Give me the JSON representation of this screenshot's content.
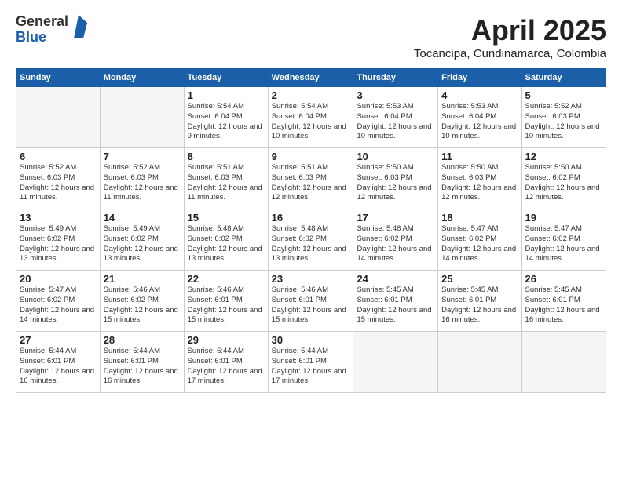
{
  "logo": {
    "general": "General",
    "blue": "Blue"
  },
  "title": "April 2025",
  "location": "Tocancipa, Cundinamarca, Colombia",
  "weekdays": [
    "Sunday",
    "Monday",
    "Tuesday",
    "Wednesday",
    "Thursday",
    "Friday",
    "Saturday"
  ],
  "weeks": [
    [
      {
        "day": "",
        "info": ""
      },
      {
        "day": "",
        "info": ""
      },
      {
        "day": "1",
        "info": "Sunrise: 5:54 AM\nSunset: 6:04 PM\nDaylight: 12 hours and 9 minutes."
      },
      {
        "day": "2",
        "info": "Sunrise: 5:54 AM\nSunset: 6:04 PM\nDaylight: 12 hours and 10 minutes."
      },
      {
        "day": "3",
        "info": "Sunrise: 5:53 AM\nSunset: 6:04 PM\nDaylight: 12 hours and 10 minutes."
      },
      {
        "day": "4",
        "info": "Sunrise: 5:53 AM\nSunset: 6:04 PM\nDaylight: 12 hours and 10 minutes."
      },
      {
        "day": "5",
        "info": "Sunrise: 5:52 AM\nSunset: 6:03 PM\nDaylight: 12 hours and 10 minutes."
      }
    ],
    [
      {
        "day": "6",
        "info": "Sunrise: 5:52 AM\nSunset: 6:03 PM\nDaylight: 12 hours and 11 minutes."
      },
      {
        "day": "7",
        "info": "Sunrise: 5:52 AM\nSunset: 6:03 PM\nDaylight: 12 hours and 11 minutes."
      },
      {
        "day": "8",
        "info": "Sunrise: 5:51 AM\nSunset: 6:03 PM\nDaylight: 12 hours and 11 minutes."
      },
      {
        "day": "9",
        "info": "Sunrise: 5:51 AM\nSunset: 6:03 PM\nDaylight: 12 hours and 12 minutes."
      },
      {
        "day": "10",
        "info": "Sunrise: 5:50 AM\nSunset: 6:03 PM\nDaylight: 12 hours and 12 minutes."
      },
      {
        "day": "11",
        "info": "Sunrise: 5:50 AM\nSunset: 6:03 PM\nDaylight: 12 hours and 12 minutes."
      },
      {
        "day": "12",
        "info": "Sunrise: 5:50 AM\nSunset: 6:02 PM\nDaylight: 12 hours and 12 minutes."
      }
    ],
    [
      {
        "day": "13",
        "info": "Sunrise: 5:49 AM\nSunset: 6:02 PM\nDaylight: 12 hours and 13 minutes."
      },
      {
        "day": "14",
        "info": "Sunrise: 5:49 AM\nSunset: 6:02 PM\nDaylight: 12 hours and 13 minutes."
      },
      {
        "day": "15",
        "info": "Sunrise: 5:48 AM\nSunset: 6:02 PM\nDaylight: 12 hours and 13 minutes."
      },
      {
        "day": "16",
        "info": "Sunrise: 5:48 AM\nSunset: 6:02 PM\nDaylight: 12 hours and 13 minutes."
      },
      {
        "day": "17",
        "info": "Sunrise: 5:48 AM\nSunset: 6:02 PM\nDaylight: 12 hours and 14 minutes."
      },
      {
        "day": "18",
        "info": "Sunrise: 5:47 AM\nSunset: 6:02 PM\nDaylight: 12 hours and 14 minutes."
      },
      {
        "day": "19",
        "info": "Sunrise: 5:47 AM\nSunset: 6:02 PM\nDaylight: 12 hours and 14 minutes."
      }
    ],
    [
      {
        "day": "20",
        "info": "Sunrise: 5:47 AM\nSunset: 6:02 PM\nDaylight: 12 hours and 14 minutes."
      },
      {
        "day": "21",
        "info": "Sunrise: 5:46 AM\nSunset: 6:02 PM\nDaylight: 12 hours and 15 minutes."
      },
      {
        "day": "22",
        "info": "Sunrise: 5:46 AM\nSunset: 6:01 PM\nDaylight: 12 hours and 15 minutes."
      },
      {
        "day": "23",
        "info": "Sunrise: 5:46 AM\nSunset: 6:01 PM\nDaylight: 12 hours and 15 minutes."
      },
      {
        "day": "24",
        "info": "Sunrise: 5:45 AM\nSunset: 6:01 PM\nDaylight: 12 hours and 15 minutes."
      },
      {
        "day": "25",
        "info": "Sunrise: 5:45 AM\nSunset: 6:01 PM\nDaylight: 12 hours and 16 minutes."
      },
      {
        "day": "26",
        "info": "Sunrise: 5:45 AM\nSunset: 6:01 PM\nDaylight: 12 hours and 16 minutes."
      }
    ],
    [
      {
        "day": "27",
        "info": "Sunrise: 5:44 AM\nSunset: 6:01 PM\nDaylight: 12 hours and 16 minutes."
      },
      {
        "day": "28",
        "info": "Sunrise: 5:44 AM\nSunset: 6:01 PM\nDaylight: 12 hours and 16 minutes."
      },
      {
        "day": "29",
        "info": "Sunrise: 5:44 AM\nSunset: 6:01 PM\nDaylight: 12 hours and 17 minutes."
      },
      {
        "day": "30",
        "info": "Sunrise: 5:44 AM\nSunset: 6:01 PM\nDaylight: 12 hours and 17 minutes."
      },
      {
        "day": "",
        "info": ""
      },
      {
        "day": "",
        "info": ""
      },
      {
        "day": "",
        "info": ""
      }
    ]
  ]
}
